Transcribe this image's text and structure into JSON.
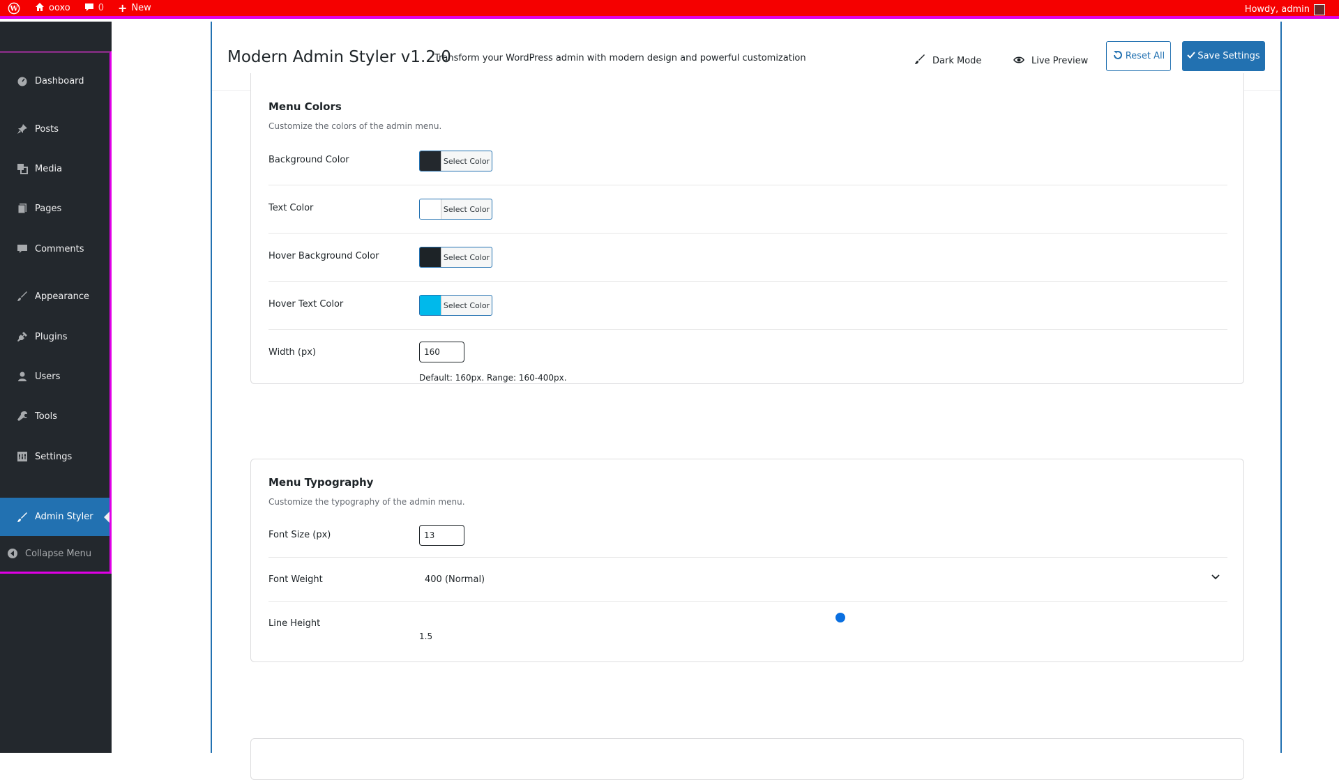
{
  "adminbar": {
    "site_name": "ooxo",
    "comments_count": "0",
    "new_label": "New",
    "howdy": "Howdy, admin"
  },
  "sidebar": {
    "items": [
      {
        "label": "Dashboard",
        "icon": "dashboard-icon"
      },
      {
        "label": "Posts",
        "icon": "pin-icon"
      },
      {
        "label": "Media",
        "icon": "media-icon"
      },
      {
        "label": "Pages",
        "icon": "pages-icon"
      },
      {
        "label": "Comments",
        "icon": "comment-icon"
      },
      {
        "label": "Appearance",
        "icon": "brush-icon"
      },
      {
        "label": "Plugins",
        "icon": "plug-icon"
      },
      {
        "label": "Users",
        "icon": "user-icon"
      },
      {
        "label": "Tools",
        "icon": "wrench-icon"
      },
      {
        "label": "Settings",
        "icon": "settings-icon"
      },
      {
        "label": "Admin Styler",
        "icon": "brush-icon",
        "active": true
      }
    ],
    "collapse_label": "Collapse Menu"
  },
  "header": {
    "title": "Modern Admin Styler v1.2.0",
    "subtitle": "Transform your WordPress admin with modern design and powerful customization",
    "dark_mode_label": "Dark Mode",
    "live_preview_label": "Live Preview",
    "reset_label": "Reset All",
    "save_label": "Save Settings"
  },
  "menu_colors": {
    "title": "Menu Colors",
    "description": "Customize the colors of the admin menu.",
    "select_color_label": "Select Color",
    "rows": [
      {
        "label": "Background Color",
        "color": "#23282d"
      },
      {
        "label": "Text Color",
        "color": "#ffffff"
      },
      {
        "label": "Hover Background Color",
        "color": "#1d2327"
      },
      {
        "label": "Hover Text Color",
        "color": "#00b9eb"
      }
    ],
    "width_label": "Width (px)",
    "width_value": "160",
    "width_hint": "Default: 160px. Range: 160-400px."
  },
  "menu_typography": {
    "title": "Menu Typography",
    "description": "Customize the typography of the admin menu.",
    "font_size_label": "Font Size (px)",
    "font_size_value": "13",
    "font_weight_label": "Font Weight",
    "font_weight_value": "400 (Normal)",
    "line_height_label": "Line Height",
    "line_height_value": "1.5"
  },
  "colors": {
    "adminbar": "#f50000",
    "accent": "#2271b1",
    "sidebar": "#23282d"
  }
}
